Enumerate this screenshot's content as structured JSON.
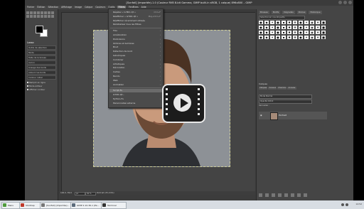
{
  "window": {
    "title": "[Sunfall] (importée)-1.0 (Couleur RVB 8-bit Gamma, GIMP built-in sRGB, 1 calque) 896x800 – GIMP"
  },
  "menubar": [
    "Fichier",
    "Édition",
    "Sélection",
    "Affichage",
    "Image",
    "Calque",
    "Couleurs",
    "Outils",
    "Filtres",
    "Fenêtres",
    "Aide"
  ],
  "menubar_active": "Filtres",
  "filters_menu": {
    "items": [
      {
        "label": "Répéter « G'MIC-Qt »",
        "shortcut": "Ctrl+F"
      },
      {
        "label": "Réafficher « G'MIC-Qt »",
        "shortcut": "Maj+Ctrl+F"
      },
      {
        "label": "Réafficher récemment utilisés",
        "shortcut": ""
      },
      {
        "label": "Réinitialiser tous les filtres",
        "shortcut": ""
      },
      {
        "label": "Flou",
        "shortcut": "›"
      },
      {
        "label": "Amélioration",
        "shortcut": "›"
      },
      {
        "label": "Distorsions",
        "shortcut": "›"
      },
      {
        "label": "Ombres et lumières",
        "shortcut": "›"
      },
      {
        "label": "Bruit",
        "shortcut": "›"
      },
      {
        "label": "Détection de bord",
        "shortcut": "›"
      },
      {
        "label": "Génériques",
        "shortcut": "›"
      },
      {
        "label": "Combiner",
        "shortcut": "›"
      },
      {
        "label": "Artistiques",
        "shortcut": "›"
      },
      {
        "label": "Décoration",
        "shortcut": "›"
      },
      {
        "label": "Cartes",
        "shortcut": "›"
      },
      {
        "label": "Rendu",
        "shortcut": "›"
      },
      {
        "label": "Web",
        "shortcut": "›"
      },
      {
        "label": "Animation",
        "shortcut": "›"
      },
      {
        "label": "Script-Fu",
        "shortcut": "›"
      },
      {
        "label": "G'MIC-Qt...",
        "shortcut": ""
      },
      {
        "label": "Python-Fu",
        "shortcut": "›"
      },
      {
        "label": "Personnalisé externe",
        "shortcut": ""
      }
    ],
    "highlighted": "Script-Fu"
  },
  "tool_options": {
    "title": "Lasso",
    "rows": [
      "Outils de sélection",
      "Mode",
      "Taille de la brosse",
      "Aucun",
      "Lissage des bords",
      "Adoucir les bords",
      "Contour initial"
    ],
    "checks": [
      "Remplir en ligne",
      "Mode éditeur",
      "Afficher contour"
    ]
  },
  "brushes": {
    "tabs": [
      "Brosses",
      "Motifs",
      "Dégradés",
      "Polices",
      "Historique"
    ],
    "filter_placeholder": "Sélectionner une étiquette"
  },
  "layers": {
    "title": "Calques",
    "tabs": [
      "Calques",
      "Canaux",
      "Chemins",
      "Annuler"
    ],
    "mode": "Mode Normal",
    "opacity": "Opacité 100,0",
    "lock": "Verrouiller :",
    "layer_name": "Portrait"
  },
  "statusbar": {
    "coords": "146.0, 89.0",
    "unit": "px",
    "zoom": "50 %",
    "name": "Portrait (25,0 Mo)"
  },
  "taskbar": {
    "items": [
      {
        "label": "Menu",
        "color": "#4f9b3c"
      },
      {
        "label": "ShotCap",
        "color": "#c0392b"
      },
      {
        "label": "[Sunfall] (importée)...",
        "color": "#777777"
      },
      {
        "label": "GIMP 2.10.36-1 (Pa...",
        "color": "#5b6b7b"
      },
      {
        "label": "Terminal",
        "color": "#333333"
      }
    ],
    "clock": "14:52"
  }
}
